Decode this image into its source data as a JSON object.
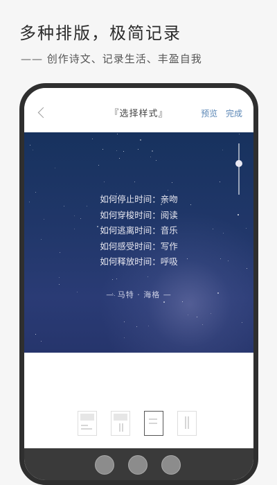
{
  "promo": {
    "headline": "多种排版，极简记录",
    "subline": "—— 创作诗文、记录生活、丰盈自我"
  },
  "header": {
    "title": "『选择样式』",
    "preview_label": "预览",
    "done_label": "完成"
  },
  "poem": {
    "lines": [
      "如何停止时间：亲吻",
      "如何穿梭时间：阅读",
      "如何逃离时间：音乐",
      "如何感受时间：写作",
      "如何释放时间：呼吸"
    ],
    "author": "— 马特 · 海格 —"
  },
  "style_options": {
    "selected_index": 2,
    "count": 4
  },
  "colors": {
    "accent": "#5b87b6",
    "sky_top": "#17325e",
    "sky_bottom": "#26356c",
    "frame": "#2f2f2f"
  }
}
